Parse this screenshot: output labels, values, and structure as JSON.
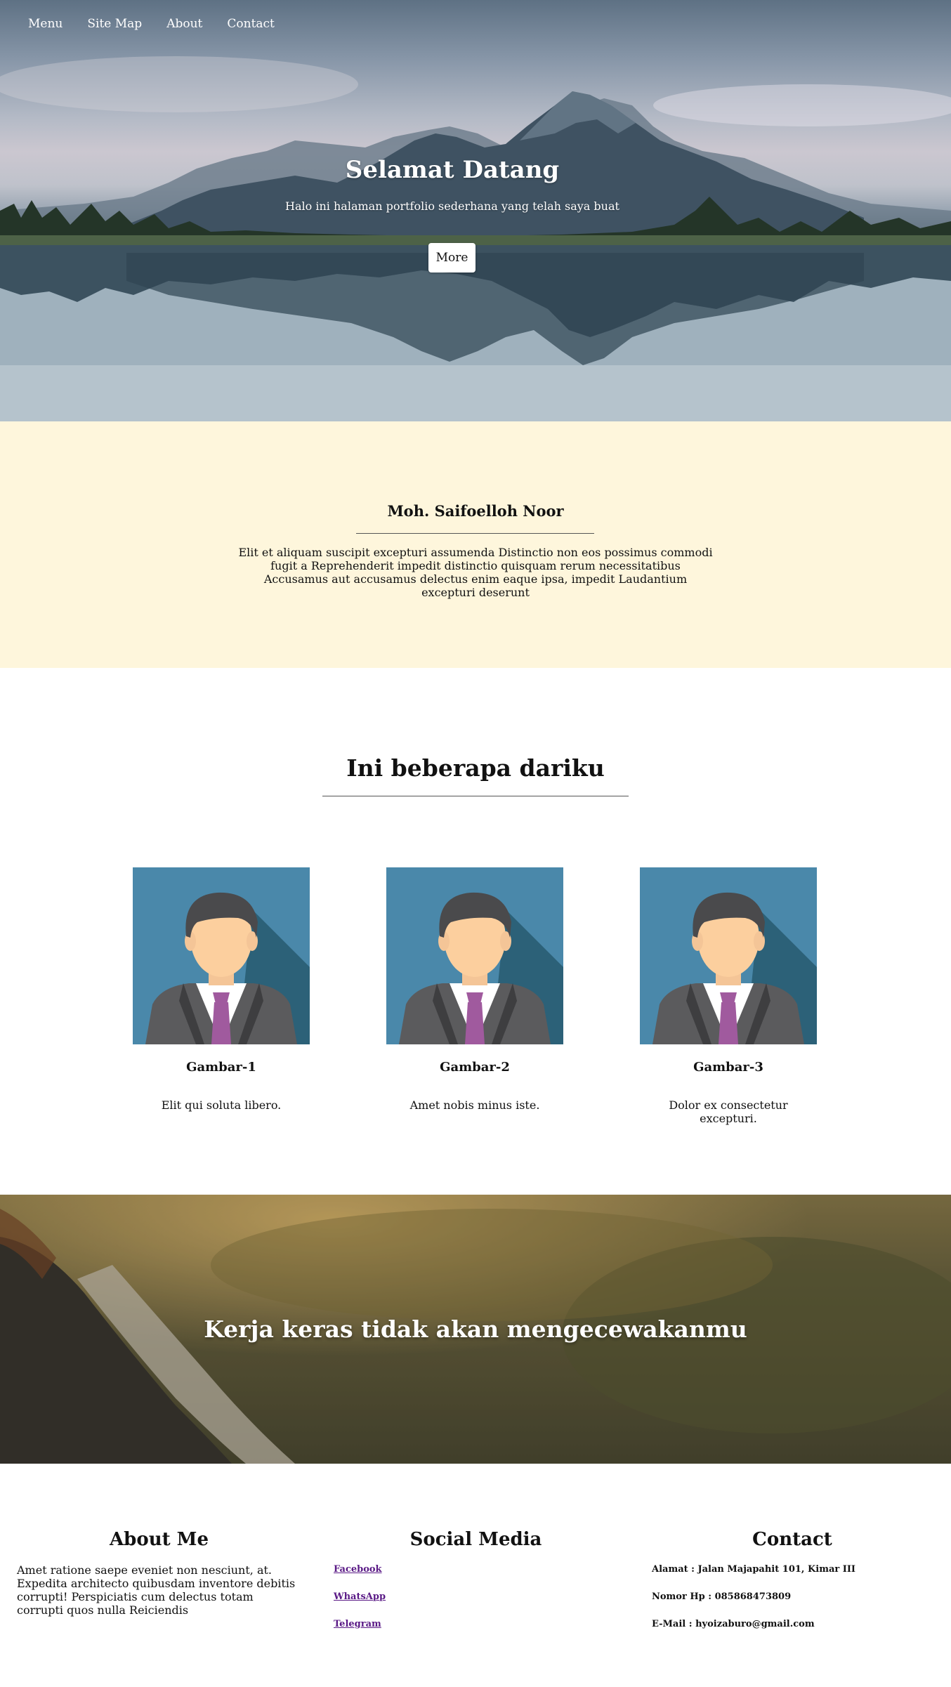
{
  "nav": {
    "items": [
      {
        "label": "Menu"
      },
      {
        "label": "Site Map"
      },
      {
        "label": "About"
      },
      {
        "label": "Contact"
      }
    ]
  },
  "hero": {
    "title": "Selamat Datang",
    "subtitle": "Halo ini halaman portfolio sederhana yang telah saya buat",
    "button_label": "More"
  },
  "about": {
    "name": "Moh. Saifoelloh Noor",
    "text": "Elit et aliquam suscipit excepturi assumenda Distinctio non eos possimus commodi fugit a Reprehenderit impedit distinctio quisquam rerum necessitatibus Accusamus aut accusamus delectus enim eaque ipsa, impedit Laudantium excepturi deserunt"
  },
  "features": {
    "title": "Ini beberapa dariku",
    "cards": [
      {
        "name": "Gambar-1",
        "desc": "Elit qui soluta libero."
      },
      {
        "name": "Gambar-2",
        "desc": "Amet nobis minus iste."
      },
      {
        "name": "Gambar-3",
        "desc": "Dolor ex consectetur excepturi."
      }
    ]
  },
  "quote": {
    "text": "Kerja keras tidak akan mengecewakanmu"
  },
  "footer": {
    "about": {
      "title": "About Me",
      "text": "Amet ratione saepe eveniet non nesciunt, at. Expedita architecto quibusdam inventore debitis corrupti! Perspiciatis cum delectus totam corrupti quos nulla Reiciendis"
    },
    "social": {
      "title": "Social Media",
      "links": [
        {
          "label": "Facebook"
        },
        {
          "label": "WhatsApp"
        },
        {
          "label": "Telegram"
        }
      ]
    },
    "contact": {
      "title": "Contact",
      "address": "Alamat : Jalan Majapahit 101, Kimar III",
      "phone": "Nomor Hp : 085868473809",
      "email": "E-Mail : hyoizaburo@gmail.com"
    }
  },
  "colors": {
    "about_bg": "#fef6dc",
    "link": "#5a1a86",
    "avatar_bg": "#4a88aa",
    "tie": "#a05a9e"
  }
}
